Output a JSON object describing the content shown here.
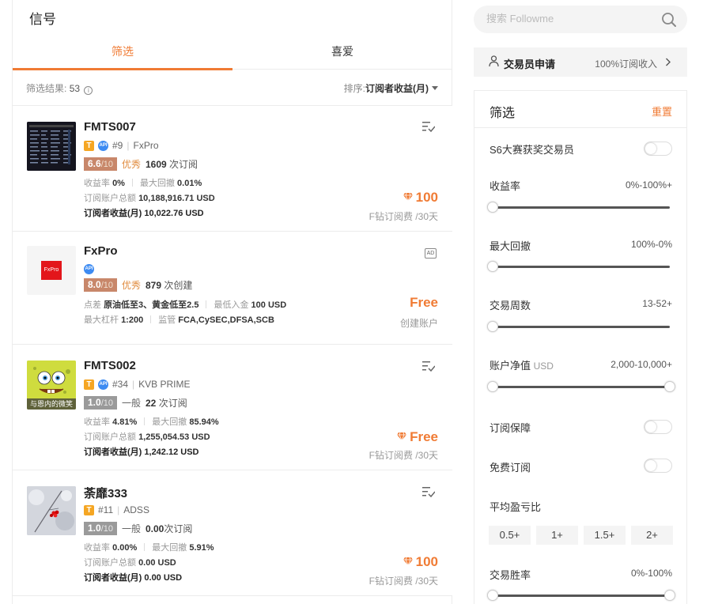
{
  "page_title": "信号",
  "tabs": [
    {
      "label": "筛选",
      "active": true
    },
    {
      "label": "喜爱",
      "active": false
    }
  ],
  "filter_bar": {
    "result_label": "筛选结果:",
    "result_count": "53",
    "info_icon": "ⓘ",
    "sort_label": "排序:",
    "sort_value": "订阅者收益(月)"
  },
  "cards": [
    {
      "name": "FMTS007",
      "rank": "#9",
      "broker": "FxPro",
      "score": "6.6",
      "score_max": "/10",
      "level": "优秀",
      "count_num": "1609",
      "count_label": "次订阅",
      "return_label": "收益率",
      "return_value": "0%",
      "drawdown_label": "最大回撤",
      "drawdown_value": "0.01%",
      "total_label": "订阅账户总额",
      "total_value": "10,188,916.71 USD",
      "monthly_label": "订阅者收益(月)",
      "monthly_value": "10,022.76 USD",
      "price": "100",
      "price_sub": "F钻订阅费 /30天"
    },
    {
      "name": "FxPro",
      "logo_text": "FxPro",
      "score": "8.0",
      "score_max": "/10",
      "level": "优秀",
      "count_num": "879",
      "count_label": "次创建",
      "spread_label": "点差",
      "spread_value": "原油低至3、黄金低至2.5",
      "deposit_label": "最低入金",
      "deposit_value": "100 USD",
      "leverage_label": "最大杠杆",
      "leverage_value": "1:200",
      "regulation_label": "监管",
      "regulation_value": "FCA,CySEC,DFSA,SCB",
      "ad_badge": "AD",
      "price": "Free",
      "price_sub": "创建账户"
    },
    {
      "name": "FMTS002",
      "rank": "#34",
      "broker": "KVB PRIME",
      "avatar_caption": "与恩内的微笑",
      "score": "1.0",
      "score_max": "/10",
      "level": "一般",
      "count_num": "22",
      "count_label": "次订阅",
      "return_label": "收益率",
      "return_value": "4.81%",
      "drawdown_label": "最大回撤",
      "drawdown_value": "85.94%",
      "total_label": "订阅账户总额",
      "total_value": "1,255,054.53 USD",
      "monthly_label": "订阅者收益(月)",
      "monthly_value": "1,242.12 USD",
      "price": "Free",
      "price_sub": "F钻订阅费 /30天"
    },
    {
      "name": "荼靡333",
      "rank": "#11",
      "broker": "ADSS",
      "score": "1.0",
      "score_max": "/10",
      "level": "一般",
      "count_num": "0.00",
      "count_label": "次订阅",
      "return_label": "收益率",
      "return_value": "0.00%",
      "drawdown_label": "最大回撤",
      "drawdown_value": "5.91%",
      "total_label": "订阅账户总额",
      "total_value": "0.00 USD",
      "monthly_label": "订阅者收益(月)",
      "monthly_value": "0.00 USD",
      "price": "100",
      "price_sub": "F钻订阅费 /30天"
    }
  ],
  "search": {
    "placeholder": "搜索 Followme"
  },
  "trader_apply": {
    "label": "交易员申请",
    "right": "100%订阅收入"
  },
  "filter_panel": {
    "title": "筛选",
    "reset": "重置",
    "s6_label": "S6大赛获奖交易员",
    "return_label": "收益率",
    "return_range": "0%-100%+",
    "drawdown_label": "最大回撤",
    "drawdown_range": "100%-0%",
    "weeks_label": "交易周数",
    "weeks_range": "13-52+",
    "equity_label": "账户净值",
    "equity_unit": "USD",
    "equity_range": "2,000-10,000+",
    "guarantee_label": "订阅保障",
    "free_label": "免费订阅",
    "ratio_label": "平均盈亏比",
    "ratio_options": [
      "0.5+",
      "1+",
      "1.5+",
      "2+"
    ],
    "winrate_label": "交易胜率",
    "winrate_range": "0%-100%"
  },
  "colors": {
    "accent": "#f07b34",
    "score_good": "#c8876a",
    "score_avg": "#9a9a9a",
    "badge_t": "#f5a623",
    "badge_api": "#3d8bf2"
  }
}
